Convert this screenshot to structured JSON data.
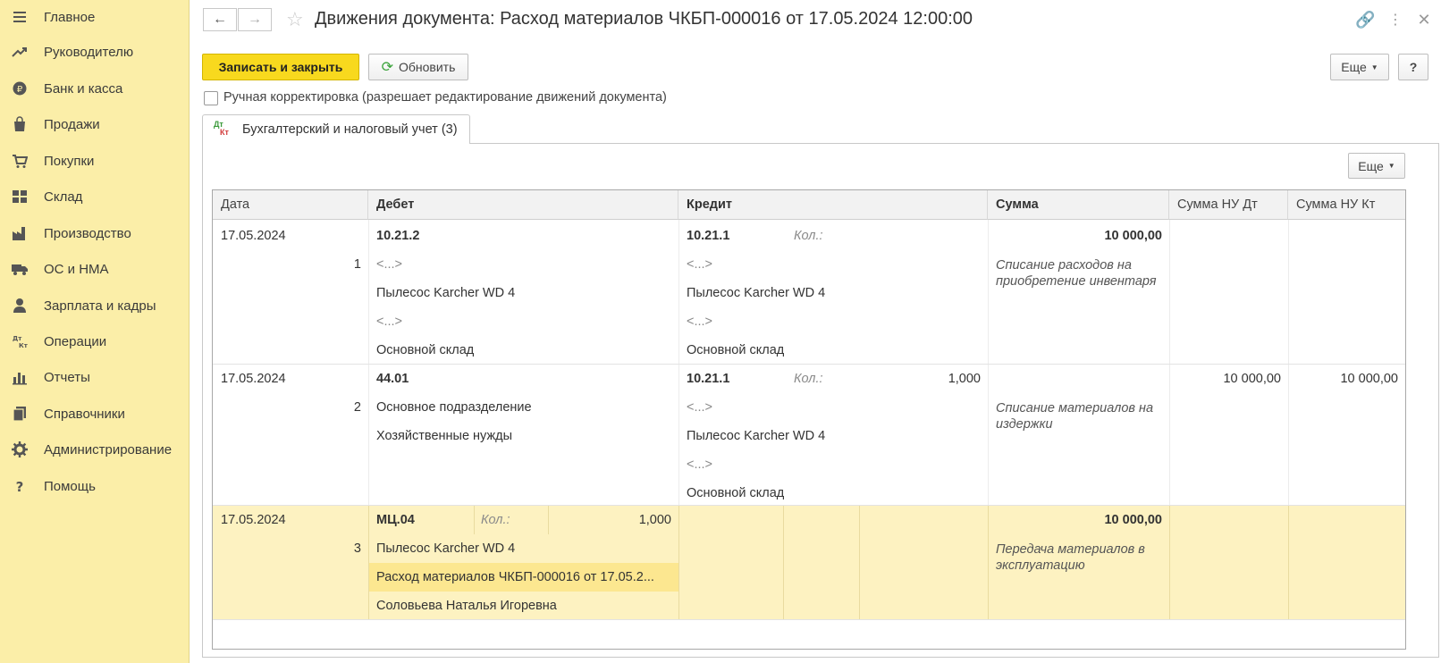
{
  "sidebar": {
    "items": [
      {
        "label": "Главное",
        "icon": "menu-lines-icon"
      },
      {
        "label": "Руководителю",
        "icon": "trend-arrow-icon"
      },
      {
        "label": "Банк и касса",
        "icon": "coin-icon"
      },
      {
        "label": "Продажи",
        "icon": "shopping-bag-icon"
      },
      {
        "label": "Покупки",
        "icon": "cart-icon"
      },
      {
        "label": "Склад",
        "icon": "warehouse-icon"
      },
      {
        "label": "Производство",
        "icon": "factory-icon"
      },
      {
        "label": "ОС и НМА",
        "icon": "truck-icon"
      },
      {
        "label": "Зарплата и кадры",
        "icon": "person-icon"
      },
      {
        "label": "Операции",
        "icon": "dt-kt-icon"
      },
      {
        "label": "Отчеты",
        "icon": "bar-chart-icon"
      },
      {
        "label": "Справочники",
        "icon": "books-icon"
      },
      {
        "label": "Администрирование",
        "icon": "gear-icon"
      },
      {
        "label": "Помощь",
        "icon": "question-icon"
      }
    ]
  },
  "header": {
    "title": "Движения документа: Расход материалов ЧКБП-000016 от 17.05.2024 12:00:00"
  },
  "toolbar": {
    "save_close": "Записать и закрыть",
    "refresh": "Обновить",
    "more": "Еще",
    "help": "?"
  },
  "manual_edit": {
    "label": "Ручная корректировка (разрешает редактирование движений документа)",
    "checked": false
  },
  "tab": {
    "label": "Бухгалтерский и налоговый учет (3)",
    "icon_top": "Дт",
    "icon_bottom": "Кт"
  },
  "panel": {
    "more": "Еще"
  },
  "table": {
    "columns": [
      "Дата",
      "Дебет",
      "Кредит",
      "Сумма",
      "Сумма НУ Дт",
      "Сумма НУ Кт"
    ],
    "qty_label": "Кол.:",
    "rows": [
      {
        "date": "17.05.2024",
        "n": "1",
        "debit": [
          "10.21.2",
          "<...>",
          "Пылесос Karcher WD 4",
          "<...>",
          "Основной склад"
        ],
        "debit_qty": "",
        "credit": [
          "10.21.1",
          "<...>",
          "Пылесос Karcher WD 4",
          "<...>",
          "Основной склад"
        ],
        "credit_qty": "",
        "sum": "10 000,00",
        "content": "Списание расходов на приобретение инвентаря",
        "nu_dt": "",
        "nu_kt": ""
      },
      {
        "date": "17.05.2024",
        "n": "2",
        "debit": [
          "44.01",
          "Основное подразделение",
          "Хозяйственные нужды"
        ],
        "debit_qty": "",
        "credit": [
          "10.21.1",
          "<...>",
          "Пылесос Karcher WD 4",
          "<...>",
          "Основной склад"
        ],
        "credit_qty": "1,000",
        "sum": "",
        "content": "Списание материалов на издержки",
        "nu_dt": "10 000,00",
        "nu_kt": "10 000,00"
      },
      {
        "date": "17.05.2024",
        "n": "3",
        "debit": [
          "МЦ.04",
          "Пылесос Karcher WD 4",
          "Расход материалов ЧКБП-000016 от 17.05.2...",
          "Соловьева Наталья Игоревна"
        ],
        "debit_qty": "1,000",
        "credit": [],
        "credit_qty": "",
        "sum": "10 000,00",
        "content": "Передача материалов в эксплуатацию",
        "nu_dt": "",
        "nu_kt": ""
      }
    ]
  }
}
